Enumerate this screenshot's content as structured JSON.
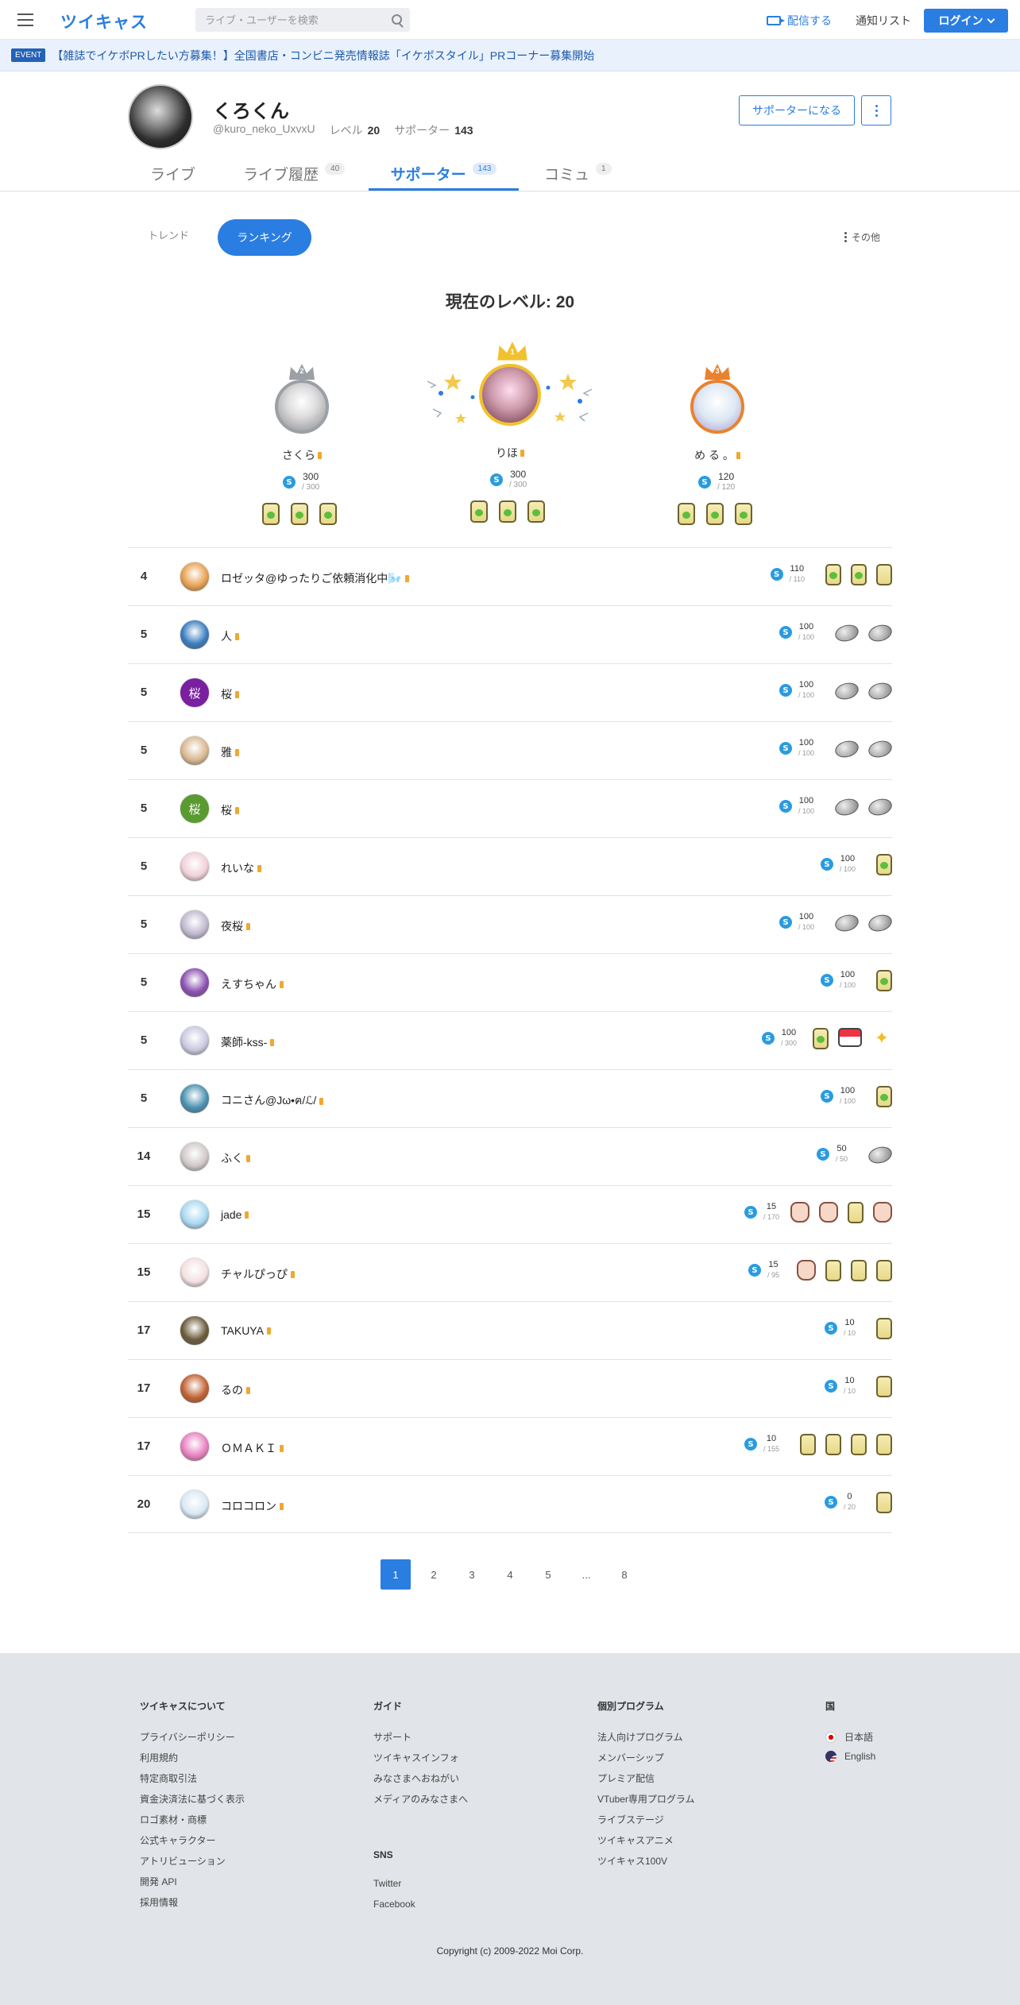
{
  "header": {
    "logo": "ツイキャス",
    "search_placeholder": "ライブ・ユーザーを検索",
    "broadcast": "配信する",
    "notify_list": "通知リスト",
    "login": "ログイン"
  },
  "event": {
    "badge": "EVENT",
    "text": "【雑誌でイケボPRしたい方募集！】全国書店・コンビニ発売情報誌「イケボスタイル」PRコーナー募集開始"
  },
  "profile": {
    "name": "くろくん",
    "handle": "@kuro_neko_UxvxU",
    "level_label": "レベル",
    "level": "20",
    "supporter_label": "サポーター",
    "supporters": "143",
    "supporter_button": "サポーターになる"
  },
  "tabs": [
    {
      "label": "ライブ",
      "count": ""
    },
    {
      "label": "ライブ履歴",
      "count": "40"
    },
    {
      "label": "サポーター",
      "count": "143"
    },
    {
      "label": "コミュ",
      "count": "1"
    }
  ],
  "subnav": {
    "trend": "トレンド",
    "ranking": "ランキング",
    "other": "その他"
  },
  "level_title": "現在のレベル: 20",
  "podium": [
    {
      "rank": "2",
      "name": "さくら",
      "points": "300",
      "max": "/ 300"
    },
    {
      "rank": "1",
      "name": "りほ",
      "points": "300",
      "max": "/ 300"
    },
    {
      "rank": "3",
      "name": "め る 。",
      "points": "120",
      "max": "/ 120"
    }
  ],
  "coin_symbol": "S",
  "rows": [
    {
      "rank": "4",
      "name": "ロゼッタ@ゆったりご依頼消化中🌬️",
      "points": "110",
      "max": "/ 110",
      "items": [
        "leaf",
        "leaf",
        "gift"
      ],
      "avatar": "#e8a050"
    },
    {
      "rank": "5",
      "name": "人",
      "points": "100",
      "max": "/ 100",
      "items": [
        "stone",
        "stone"
      ],
      "avatar": "#3a7cc0"
    },
    {
      "rank": "5",
      "name": "桜",
      "points": "100",
      "max": "/ 100",
      "items": [
        "stone",
        "stone"
      ],
      "avatar": "#7a1fa0",
      "glyph": "桜"
    },
    {
      "rank": "5",
      "name": "雅",
      "points": "100",
      "max": "/ 100",
      "items": [
        "stone",
        "stone"
      ],
      "avatar": "#d8b890"
    },
    {
      "rank": "5",
      "name": "桜",
      "points": "100",
      "max": "/ 100",
      "items": [
        "stone",
        "stone"
      ],
      "avatar": "#5a9a30",
      "glyph": "桜"
    },
    {
      "rank": "5",
      "name": "れいな",
      "points": "100",
      "max": "/ 100",
      "items": [
        "leaf"
      ],
      "avatar": "#f0d0d8"
    },
    {
      "rank": "5",
      "name": "夜桜",
      "points": "100",
      "max": "/ 100",
      "items": [
        "stone",
        "stone"
      ],
      "avatar": "#c0b8d0"
    },
    {
      "rank": "5",
      "name": "えすちゃん",
      "points": "100",
      "max": "/ 100",
      "items": [
        "leaf"
      ],
      "avatar": "#8a50b0"
    },
    {
      "rank": "5",
      "name": "薬師-kss-",
      "points": "100",
      "max": "/ 300",
      "items": [
        "leaf",
        "sushi",
        "star"
      ],
      "avatar": "#c8c8e0"
    },
    {
      "rank": "5",
      "name": "コニさん@Jω•ฅ/ℒ/",
      "points": "100",
      "max": "/ 100",
      "items": [
        "leaf"
      ],
      "avatar": "#4a90b0"
    },
    {
      "rank": "14",
      "name": "ふく",
      "points": "50",
      "max": "/ 50",
      "items": [
        "stone"
      ],
      "avatar": "#d0c8c8"
    },
    {
      "rank": "15",
      "name": "jade",
      "points": "15",
      "max": "/ 170",
      "items": [
        "clap",
        "clap",
        "gift",
        "clap"
      ],
      "avatar": "#a8d8f0"
    },
    {
      "rank": "15",
      "name": "チャルぴっぴ",
      "points": "15",
      "max": "/ 95",
      "items": [
        "clap",
        "gift",
        "gift",
        "gift"
      ],
      "avatar": "#f4e0e0"
    },
    {
      "rank": "17",
      "name": "TAKUYA",
      "points": "10",
      "max": "/ 10",
      "items": [
        "gift"
      ],
      "avatar": "#6a5a3a"
    },
    {
      "rank": "17",
      "name": "るの",
      "points": "10",
      "max": "/ 10",
      "items": [
        "gift"
      ],
      "avatar": "#c06030"
    },
    {
      "rank": "17",
      "name": "ＯＭＡＫＩ",
      "points": "10",
      "max": "/ 155",
      "items": [
        "gift",
        "gift",
        "gift",
        "gift"
      ],
      "avatar": "#e880c0"
    },
    {
      "rank": "20",
      "name": "コロコロン",
      "points": "0",
      "max": "/ 20",
      "items": [
        "gift"
      ],
      "avatar": "#d8e8f4"
    }
  ],
  "pager": [
    "1",
    "2",
    "3",
    "4",
    "5",
    "...",
    "8"
  ],
  "footer": {
    "cols": [
      {
        "title": "ツイキャスについて",
        "links": [
          "プライバシーポリシー",
          "利用規約",
          "特定商取引法",
          "資金決済法に基づく表示",
          "ロゴ素材・商標",
          "公式キャラクター",
          "アトリビューション",
          "開発 API",
          "採用情報"
        ]
      },
      {
        "title": "ガイド",
        "links": [
          "サポート",
          "ツイキャスインフォ",
          "みなさまへおねがい",
          "メディアのみなさまへ"
        ]
      },
      {
        "title": "個別プログラム",
        "links": [
          "法人向けプログラム",
          "メンバーシップ",
          "プレミア配信",
          "VTuber専用プログラム",
          "ライブステージ",
          "ツイキャスアニメ",
          "ツイキャス100V"
        ]
      },
      {
        "title": "国",
        "links": [
          "日本語",
          "English"
        ]
      }
    ],
    "sns_title": "SNS",
    "sns": [
      "Twitter",
      "Facebook"
    ],
    "copyright": "Copyright (c) 2009-2022 Moi Corp."
  }
}
